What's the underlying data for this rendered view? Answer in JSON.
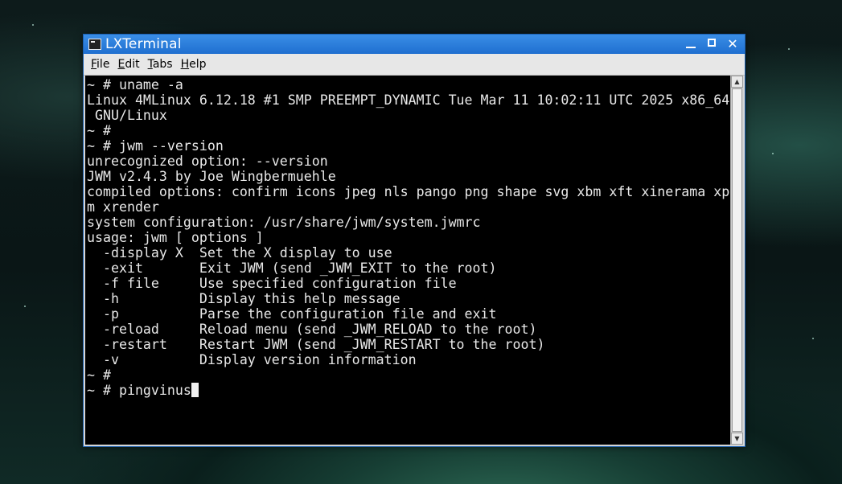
{
  "window": {
    "title": "LXTerminal",
    "icon": "terminal-icon",
    "controls": {
      "minimize": "minimize-icon",
      "maximize": "maximize-icon",
      "close": "✕"
    }
  },
  "menu": [
    {
      "first": "F",
      "rest": "ile"
    },
    {
      "first": "E",
      "rest": "dit"
    },
    {
      "first": "T",
      "rest": "abs"
    },
    {
      "first": "H",
      "rest": "elp"
    }
  ],
  "terminal": {
    "lines": [
      "~ # uname -a",
      "Linux 4MLinux 6.12.18 #1 SMP PREEMPT_DYNAMIC Tue Mar 11 10:02:11 UTC 2025 x86_64",
      " GNU/Linux",
      "~ #",
      "~ # jwm --version",
      "unrecognized option: --version",
      "JWM v2.4.3 by Joe Wingbermuehle",
      "compiled options: confirm icons jpeg nls pango png shape svg xbm xft xinerama xp",
      "m xrender",
      "system configuration: /usr/share/jwm/system.jwmrc",
      "usage: jwm [ options ]",
      "  -display X  Set the X display to use",
      "  -exit       Exit JWM (send _JWM_EXIT to the root)",
      "  -f file     Use specified configuration file",
      "  -h          Display this help message",
      "  -p          Parse the configuration file and exit",
      "  -reload     Reload menu (send _JWM_RELOAD to the root)",
      "  -restart    Restart JWM (send _JWM_RESTART to the root)",
      "  -v          Display version information",
      "~ #"
    ],
    "current_input": "~ # pingvinus"
  },
  "scrollbar": {
    "up": "▲",
    "down": "▼"
  }
}
